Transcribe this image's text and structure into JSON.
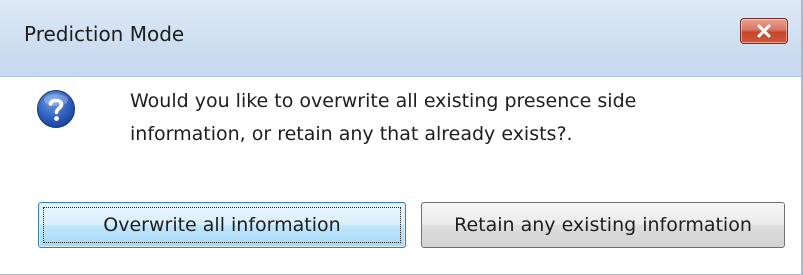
{
  "dialog": {
    "title": "Prediction Mode",
    "close_icon": "close-icon",
    "question_icon": "question-icon",
    "message_line1": "Would you like to overwrite all existing presence side",
    "message_line2": "information, or retain any that already exists?."
  },
  "buttons": {
    "overwrite_label": "Overwrite all information",
    "retain_label": "Retain any existing information"
  },
  "colors": {
    "close_button": "#c6452b",
    "default_button_border": "#3c7fb1",
    "titlebar": "#cfdff1"
  }
}
